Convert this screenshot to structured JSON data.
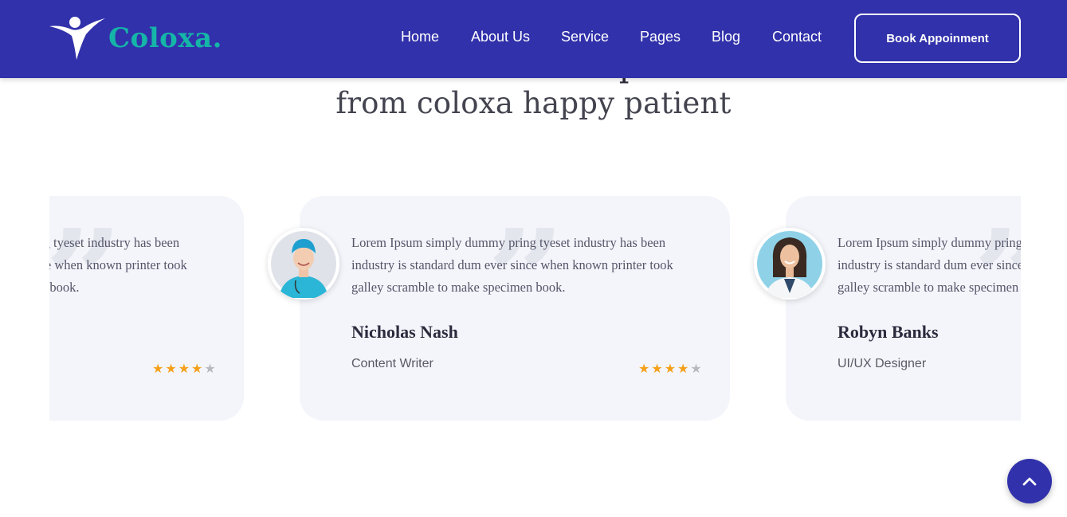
{
  "brand": {
    "name": "Coloxa.",
    "logo_icon": "person-logo-icon",
    "text_color": "#15b5a7",
    "header_color": "#3131ab"
  },
  "nav": {
    "items": [
      "Home",
      "About Us",
      "Service",
      "Pages",
      "Blog",
      "Contact"
    ],
    "cta_label": "Book Appoinment"
  },
  "section": {
    "heading_partial": "p",
    "subheading": "from coloxa happy patient"
  },
  "testimonials": [
    {
      "text": "Lorem Ipsum simply dummy pring tyeset industry has been industry is standard dum ever since when known printer took galley scramble to make specimen book.",
      "name": "",
      "role": "",
      "rating": 4
    },
    {
      "text": "Lorem Ipsum simply dummy pring tyeset industry has been industry is standard dum ever since when known printer took galley scramble to make specimen book.",
      "name": "Nicholas Nash",
      "role": "Content Writer",
      "rating": 4
    },
    {
      "text": "Lorem Ipsum simply dummy pring tyeset industry has been industry is standard dum ever since when known printer took galley scramble to make specimen book.",
      "name": "Robyn Banks",
      "role": "UI/UX Designer",
      "rating": 4
    }
  ],
  "colors": {
    "star_filled": "#f5a019",
    "star_empty": "#b8b8c0",
    "accent": "#3131ab"
  },
  "back_to_top_icon": "chevron-up-icon"
}
